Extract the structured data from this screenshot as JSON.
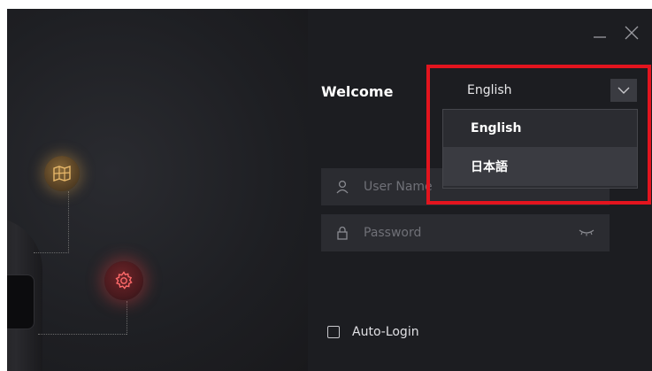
{
  "header": {
    "welcome_text": "Welcome"
  },
  "language": {
    "selected": "English",
    "options": [
      "English",
      "日本語"
    ],
    "hovered_index": 1
  },
  "login": {
    "username_placeholder": "User Name",
    "password_placeholder": "Password",
    "auto_login_label": "Auto-Login",
    "auto_login_checked": false
  },
  "icons": {
    "minimize": "minimize-icon",
    "close": "close-icon",
    "dropdown": "chevron-down-icon",
    "user": "user-icon",
    "lock": "lock-icon",
    "eye": "eye-closed-icon",
    "map": "map-icon",
    "gear": "gear-icon"
  },
  "colors": {
    "window_bg": "#1c1d21",
    "field_bg": "#2b2c31",
    "highlight": "#e3141e",
    "map_accent": "#d9a55a",
    "gear_accent": "#e04848"
  }
}
